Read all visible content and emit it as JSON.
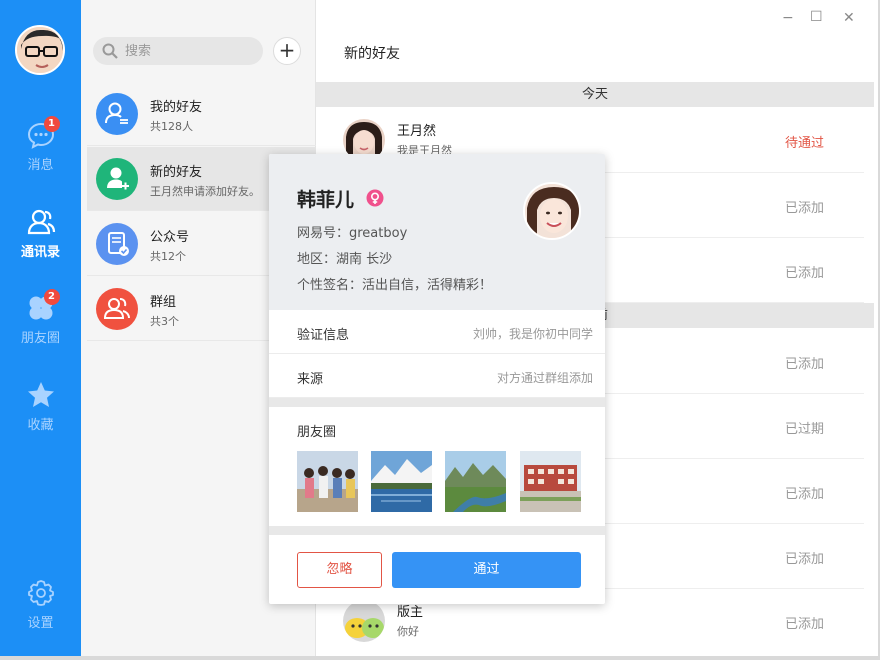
{
  "rail": {
    "items": [
      {
        "label": "消息",
        "badge": "1"
      },
      {
        "label": "通讯录"
      },
      {
        "label": "朋友圈",
        "badge": "2"
      },
      {
        "label": "收藏"
      },
      {
        "label": "设置"
      }
    ],
    "active_index": 1
  },
  "contacts": {
    "search_placeholder": "搜索",
    "add_label": "+",
    "items": [
      {
        "title": "我的好友",
        "subtitle": "共128人"
      },
      {
        "title": "新的好友",
        "subtitle": "王月然申请添加好友。"
      },
      {
        "title": "公众号",
        "subtitle": "共12个"
      },
      {
        "title": "群组",
        "subtitle": "共3个"
      }
    ],
    "selected_index": 1
  },
  "window": {
    "minimize": "−",
    "maximize": "☐",
    "close": "✕"
  },
  "main": {
    "title": "新的好友",
    "day_today": "今天",
    "day_partial": "前",
    "requests": [
      {
        "name": "王月然",
        "message": "我是王月然",
        "state": "待通过"
      },
      {
        "state": "已添加"
      },
      {
        "state": "已添加"
      },
      {
        "state": "已添加"
      },
      {
        "state": "已过期"
      },
      {
        "state": "已添加"
      },
      {
        "state": "已添加"
      },
      {
        "name": "版主",
        "message": "你好",
        "state": "已添加"
      }
    ]
  },
  "card": {
    "name": "韩菲儿",
    "netease_id": "网易号：greatboy",
    "region": "地区：湖南 长沙",
    "signature": "个性签名：活出自信，活得精彩！",
    "verify_label": "验证信息",
    "verify_value": "刘帅，我是你初中同学",
    "source_label": "来源",
    "source_value": "对方通过群组添加",
    "moments_label": "朋友圈",
    "ignore_label": "忽略",
    "pass_label": "通过"
  },
  "colors": {
    "rail": "#1c8ff6",
    "accent": "#3593f5",
    "pending": "#e25545",
    "badge": "#f04a3e",
    "female": "#f0508c"
  }
}
